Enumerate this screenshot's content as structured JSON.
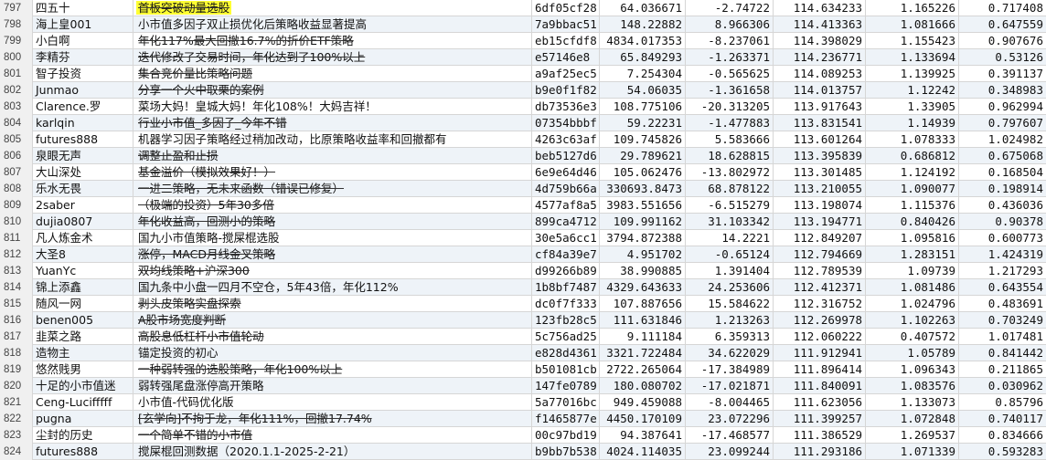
{
  "rows": [
    {
      "n": "797",
      "user": "四五十",
      "title": "首板突破动量选股",
      "id": "6df05cf28",
      "v1": "64.036671",
      "v2": "-2.74722",
      "v3": "114.634233",
      "v4": "1.165226",
      "v5": "0.717408",
      "hl": true,
      "strike": true
    },
    {
      "n": "798",
      "user": "海上皇001",
      "title": "小市值多因子双止损优化后策略收益显著提高",
      "id": "7a9bbac51",
      "v1": "148.22882",
      "v2": "8.966306",
      "v3": "114.413363",
      "v4": "1.081666",
      "v5": "0.647559",
      "strike": false
    },
    {
      "n": "799",
      "user": "小白啊",
      "title": "年化117%最大回撤16.7%的折价ETF策略",
      "id": "eb15cfdf8",
      "v1": "4834.017353",
      "v2": "-8.237061",
      "v3": "114.398029",
      "v4": "1.155423",
      "v5": "0.907676",
      "strike": true
    },
    {
      "n": "800",
      "user": "李精芬",
      "title": "迭代修改了交易时间，年化达到了100%以上",
      "id": "e57146e8",
      "v1": "65.849293",
      "v2": "-1.263371",
      "v3": "114.236771",
      "v4": "1.133694",
      "v5": "0.53126",
      "strike": true
    },
    {
      "n": "801",
      "user": "智子投资",
      "title": "集合竞价量比策略问题",
      "id": "a9af25ec5",
      "v1": "7.254304",
      "v2": "-0.565625",
      "v3": "114.089253",
      "v4": "1.139925",
      "v5": "0.391137",
      "strike": true
    },
    {
      "n": "802",
      "user": "Junmao",
      "title": "分享一个火中取栗的案例",
      "id": "b9e0f1f82",
      "v1": "54.06035",
      "v2": "-1.361658",
      "v3": "114.013757",
      "v4": "1.12242",
      "v5": "0.348983",
      "strike": true
    },
    {
      "n": "803",
      "user": "Clarence.罗",
      "title": "菜场大妈！皇城大妈！年化108%！大妈吉祥！",
      "id": "db73536e3",
      "v1": "108.775106",
      "v2": "-20.313205",
      "v3": "113.917643",
      "v4": "1.33905",
      "v5": "0.962994",
      "strike": false
    },
    {
      "n": "804",
      "user": "karlqin",
      "title": "行业小市值_多因子_今年不错",
      "id": "07354bbbf",
      "v1": "59.22231",
      "v2": "-1.477883",
      "v3": "113.831541",
      "v4": "1.14939",
      "v5": "0.797607",
      "strike": true
    },
    {
      "n": "805",
      "user": "futures888",
      "title": "机器学习因子策略经过稍加改动，比原策略收益率和回撤都有",
      "id": "4263c63af",
      "v1": "109.745826",
      "v2": "5.583666",
      "v3": "113.601264",
      "v4": "1.078333",
      "v5": "1.024982",
      "strike": false
    },
    {
      "n": "806",
      "user": "泉眼无声",
      "title": "调整止盈和止损",
      "id": "beb5127d6",
      "v1": "29.789621",
      "v2": "18.628815",
      "v3": "113.395839",
      "v4": "0.686812",
      "v5": "0.675068",
      "strike": true
    },
    {
      "n": "807",
      "user": "大山深处",
      "title": "基金溢价（模拟效果好！）",
      "id": "6e9e64d46",
      "v1": "105.062476",
      "v2": "-13.802972",
      "v3": "113.301485",
      "v4": "1.124192",
      "v5": "0.168504",
      "strike": true
    },
    {
      "n": "808",
      "user": "乐水无畏",
      "title": "一进二策略，无未来函数（错误已修复）",
      "id": "4d759b66a",
      "v1": "330693.8473",
      "v2": "68.878122",
      "v3": "113.210055",
      "v4": "1.090077",
      "v5": "0.198914",
      "strike": true
    },
    {
      "n": "809",
      "user": "2saber",
      "title": "（极端的投资）5年30多倍",
      "id": "4577af8a5",
      "v1": "3983.551656",
      "v2": "-6.515279",
      "v3": "113.198074",
      "v4": "1.115376",
      "v5": "0.436036",
      "strike": true
    },
    {
      "n": "810",
      "user": "dujia0807",
      "title": "年化收益高，回测小的策略",
      "id": "899ca4712",
      "v1": "109.991162",
      "v2": "31.103342",
      "v3": "113.194771",
      "v4": "0.840426",
      "v5": "0.90378",
      "strike": true
    },
    {
      "n": "811",
      "user": "凡人炼金术",
      "title": "国九小市值策略-搅屎棍选股",
      "id": "30e5a6cc1",
      "v1": "3794.872388",
      "v2": "14.2221",
      "v3": "112.849207",
      "v4": "1.095816",
      "v5": "0.600773",
      "strike": false
    },
    {
      "n": "812",
      "user": "大圣8",
      "title": "涨停，MACD月线金叉策略",
      "id": "cf84a39e7",
      "v1": "4.951702",
      "v2": "-0.65124",
      "v3": "112.794669",
      "v4": "1.283151",
      "v5": "1.424319",
      "strike": true
    },
    {
      "n": "813",
      "user": "YuanYc",
      "title": "双均线策略+沪深300",
      "id": "d99266b89",
      "v1": "38.990885",
      "v2": "1.391404",
      "v3": "112.789539",
      "v4": "1.09739",
      "v5": "1.217293",
      "strike": true
    },
    {
      "n": "814",
      "user": "锦上添鑫",
      "title": "国九条中小盘一四月不空仓，5年43倍，年化112%",
      "id": "1b8bf7487",
      "v1": "4329.643633",
      "v2": "24.253606",
      "v3": "112.412371",
      "v4": "1.081486",
      "v5": "0.643554",
      "strike": false
    },
    {
      "n": "815",
      "user": "随风一网",
      "title": "剥头皮策略实盘探索",
      "id": "dc0f7f333",
      "v1": "107.887656",
      "v2": "15.584622",
      "v3": "112.316752",
      "v4": "1.024796",
      "v5": "0.483691",
      "strike": true
    },
    {
      "n": "816",
      "user": "benen005",
      "title": "A股市场宽度判断",
      "id": "123fb28c5",
      "v1": "111.631846",
      "v2": "1.213263",
      "v3": "112.269978",
      "v4": "1.102263",
      "v5": "0.703249",
      "strike": true
    },
    {
      "n": "817",
      "user": "韭菜之路",
      "title": "高股息低杠杆小市值轮动",
      "id": "5c756ad25",
      "v1": "9.111184",
      "v2": "6.359313",
      "v3": "112.060222",
      "v4": "0.407572",
      "v5": "1.017481",
      "strike": true
    },
    {
      "n": "818",
      "user": "造物主",
      "title": "锚定投资的初心",
      "id": "e828d4361",
      "v1": "3321.722484",
      "v2": "34.622029",
      "v3": "111.912941",
      "v4": "1.05789",
      "v5": "0.841442",
      "strike": false
    },
    {
      "n": "819",
      "user": "悠然贱男",
      "title": "一种弱转强的选股策略，年化100%以上",
      "id": "b501081cb",
      "v1": "2722.265064",
      "v2": "-17.384989",
      "v3": "111.896414",
      "v4": "1.096343",
      "v5": "0.211865",
      "strike": true
    },
    {
      "n": "820",
      "user": "十足的小市值迷",
      "title": "弱转强尾盘涨停高开策略",
      "id": "147fe0789",
      "v1": "180.080702",
      "v2": "-17.021871",
      "v3": "111.840091",
      "v4": "1.083576",
      "v5": "0.030962",
      "strike": false
    },
    {
      "n": "821",
      "user": "Ceng-Lucifffff",
      "title": "小市值-代码优化版",
      "id": "5a77016bc",
      "v1": "949.459088",
      "v2": "-8.004465",
      "v3": "111.623056",
      "v4": "1.133073",
      "v5": "0.85796",
      "strike": false
    },
    {
      "n": "822",
      "user": "pugna",
      "title": "[玄学向]不拘于龙，年化111%，回撤17.74%",
      "id": "f1465877e",
      "v1": "4450.170109",
      "v2": "23.072296",
      "v3": "111.399257",
      "v4": "1.072848",
      "v5": "0.740117",
      "strike": true
    },
    {
      "n": "823",
      "user": "尘封的历史",
      "title": "一个简单不错的小市值",
      "id": "00c97bd19",
      "v1": "94.387641",
      "v2": "-17.468577",
      "v3": "111.386529",
      "v4": "1.269537",
      "v5": "0.834666",
      "strike": true
    },
    {
      "n": "824",
      "user": "futures888",
      "title": "搅屎棍回测数据（2020.1.1-2025-2-21）",
      "id": "b9bb7b538",
      "v1": "4024.114035",
      "v2": "23.099244",
      "v3": "111.293186",
      "v4": "1.071339",
      "v5": "0.593283",
      "strike": false
    }
  ]
}
